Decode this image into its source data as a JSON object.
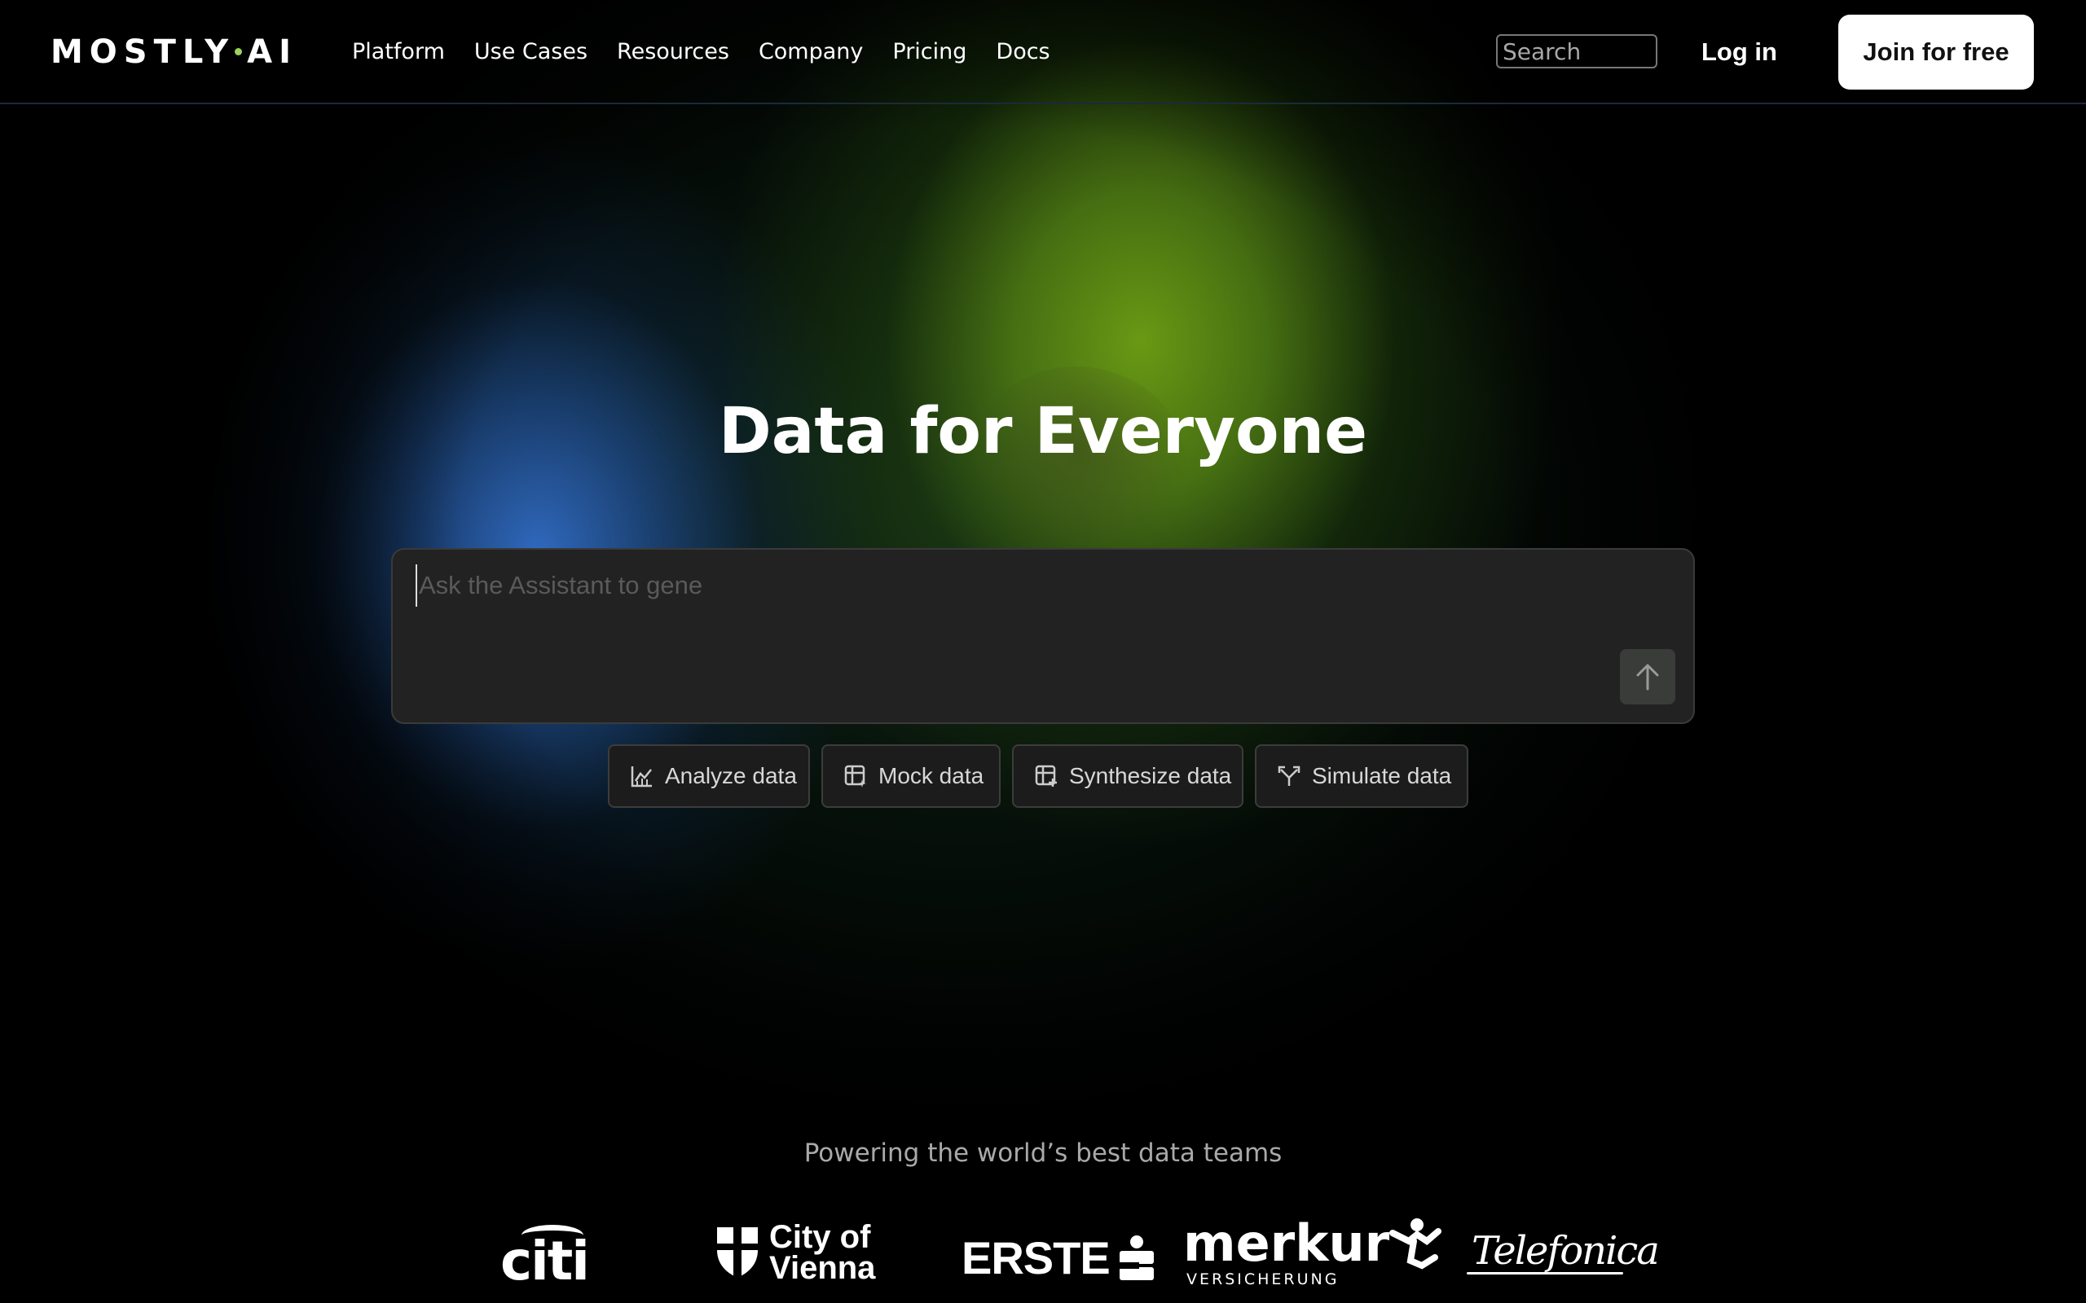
{
  "header": {
    "logo": "MOSTLY",
    "logo_suffix": "AI",
    "nav": [
      "Platform",
      "Use Cases",
      "Resources",
      "Company",
      "Pricing",
      "Docs"
    ],
    "search_placeholder": "Search",
    "login_label": "Log in",
    "join_label": "Join for free"
  },
  "hero": {
    "title": "Data for Everyone",
    "prompt_placeholder": "Ask the Assistant to gene",
    "send_icon": "arrow-up-icon"
  },
  "chips": [
    {
      "label": "Analyze data",
      "icon": "chart-icon"
    },
    {
      "label": "Mock data",
      "icon": "table-sparkle-icon"
    },
    {
      "label": "Synthesize data",
      "icon": "table-plus-icon"
    },
    {
      "label": "Simulate data",
      "icon": "branch-icon"
    }
  ],
  "customers": {
    "tagline": "Powering the world’s best data teams",
    "logos": {
      "citi": "citi",
      "vienna_line1": "City of",
      "vienna_line2": "Vienna",
      "erste": "ERSTE",
      "merkur": "merkur",
      "merkur_sub": "VERSICHERUNG",
      "telefonica": "Telefonica"
    }
  }
}
